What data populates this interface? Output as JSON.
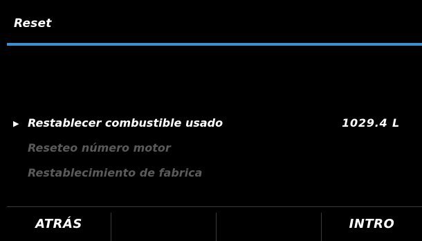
{
  "header": {
    "title": "Reset",
    "accent_color": "#3b8fd6"
  },
  "menu": {
    "items": [
      {
        "label": "Restablecer combustible usado",
        "value": "1029.4 L",
        "state": "selected",
        "marker": "▶"
      },
      {
        "label": "Reseteo número motor",
        "value": "",
        "state": "disabled"
      },
      {
        "label": "Restablecimiento de fabrica",
        "value": "",
        "state": "disabled"
      }
    ]
  },
  "footer": {
    "soft_keys": [
      {
        "label": "ATRÁS"
      },
      {
        "label": ""
      },
      {
        "label": ""
      },
      {
        "label": "INTRO"
      }
    ]
  }
}
